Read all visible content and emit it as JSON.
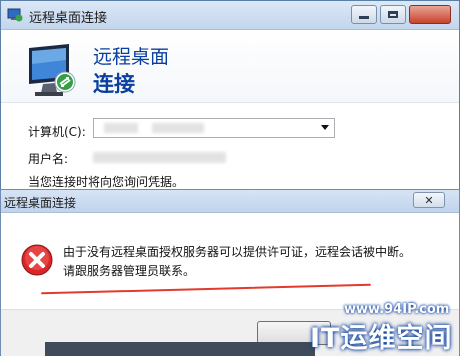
{
  "window": {
    "title": "远程桌面连接",
    "header_line1": "远程桌面",
    "header_line2": "连接"
  },
  "form": {
    "computer_label": "计算机(C):",
    "user_label": "用户名:",
    "hint": "当您连接时将向您询问凭据。"
  },
  "dialog": {
    "title": "远程桌面连接",
    "close_glyph": "✕",
    "message_line1": "由于没有远程桌面授权服务器可以提供许可证，远程会话被中断。",
    "message_line2": "请跟服务器管理员联系。"
  },
  "watermark": {
    "url": "www.94IP.com",
    "text": "IT运维空间"
  },
  "colors": {
    "accent": "#0a3f9e",
    "error": "#d9262a"
  },
  "icons": [
    "rdp-app-icon",
    "remote-desktop-monitor-icon",
    "error-icon"
  ]
}
